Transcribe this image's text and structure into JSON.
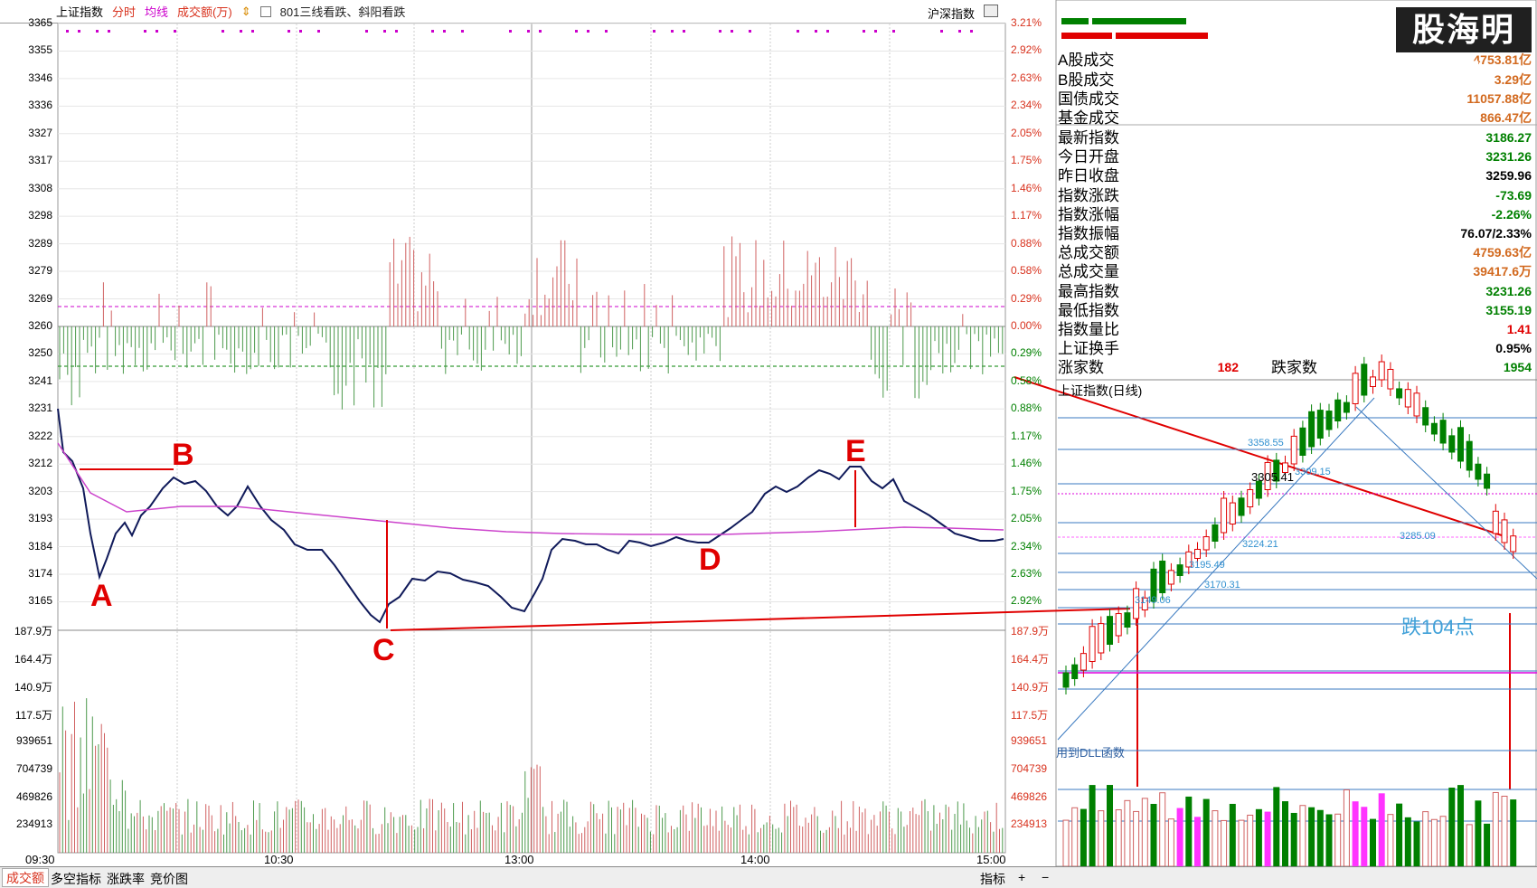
{
  "topbar": {
    "title": "上证指数",
    "tab_intraday": "分时",
    "tab_avg": "均线",
    "tab_volume": "成交额(万)",
    "note": "801三线看跌、斜阳看跌",
    "market": "沪深指数"
  },
  "left_price_axis": [
    "3365",
    "3355",
    "3346",
    "3336",
    "3327",
    "3317",
    "3308",
    "3298",
    "3289",
    "3279",
    "3269",
    "3260",
    "3250",
    "3241",
    "3231",
    "3222",
    "3212",
    "3203",
    "3193",
    "3184",
    "3174",
    "3165"
  ],
  "right_pct_axis": [
    "3.21%",
    "2.92%",
    "2.63%",
    "2.34%",
    "2.05%",
    "1.75%",
    "1.46%",
    "1.17%",
    "0.88%",
    "0.58%",
    "0.29%",
    "0.00%",
    "0.29%",
    "0.58%",
    "0.88%",
    "1.17%",
    "1.46%",
    "1.75%",
    "2.05%",
    "2.34%",
    "2.63%",
    "2.92%"
  ],
  "volume_axis": [
    "187.9万",
    "164.4万",
    "140.9万",
    "117.5万",
    "939651",
    "704739",
    "469826",
    "234913"
  ],
  "time_axis": [
    "09:30",
    "10:30",
    "13:00",
    "14:00",
    "15:00"
  ],
  "annotations": {
    "A": "A",
    "B": "B",
    "C": "C",
    "D": "D",
    "E": "E"
  },
  "stats": {
    "rows": [
      {
        "k": "A股成交",
        "v": "4753.81亿",
        "c": "orange"
      },
      {
        "k": "B股成交",
        "v": "3.29亿",
        "c": "orange"
      },
      {
        "k": "国债成交",
        "v": "11057.88亿",
        "c": "orange"
      },
      {
        "k": "基金成交",
        "v": "866.47亿",
        "c": "orange"
      },
      {
        "k": "最新指数",
        "v": "3186.27",
        "c": "green"
      },
      {
        "k": "今日开盘",
        "v": "3231.26",
        "c": "green"
      },
      {
        "k": "昨日收盘",
        "v": "3259.96",
        "c": "black"
      },
      {
        "k": "指数涨跌",
        "v": "-73.69",
        "c": "green"
      },
      {
        "k": "指数涨幅",
        "v": "-2.26%",
        "c": "green"
      },
      {
        "k": "指数振幅",
        "v": "76.07/2.33%",
        "c": "black"
      },
      {
        "k": "总成交额",
        "v": "4759.63亿",
        "c": "orange"
      },
      {
        "k": "总成交量",
        "v": "39417.6万",
        "c": "orange"
      },
      {
        "k": "最高指数",
        "v": "3231.26",
        "c": "green"
      },
      {
        "k": "最低指数",
        "v": "3155.19",
        "c": "green"
      },
      {
        "k": "指数量比",
        "v": "1.41",
        "c": "red"
      },
      {
        "k": "上证换手",
        "v": "0.95%",
        "c": "black"
      }
    ],
    "rise_label": "涨家数",
    "rise": "182",
    "fall_label": "跌家数",
    "fall": "1954"
  },
  "daily": {
    "title": "上证指数(日线)",
    "notes": [
      "3358.55",
      "3305.41",
      "3309.15",
      "3224.21",
      "3285.09",
      "3195.49",
      "3170.31",
      "3149.06"
    ],
    "drop_label": "跌104点",
    "dll_text": "用到DLL函数"
  },
  "watermark": "股海明灯",
  "bottom_tabs": [
    "成交额",
    "多空指标",
    "涨跌率",
    "竞价图"
  ],
  "bottom_right": [
    "指标",
    "+",
    "−"
  ]
}
